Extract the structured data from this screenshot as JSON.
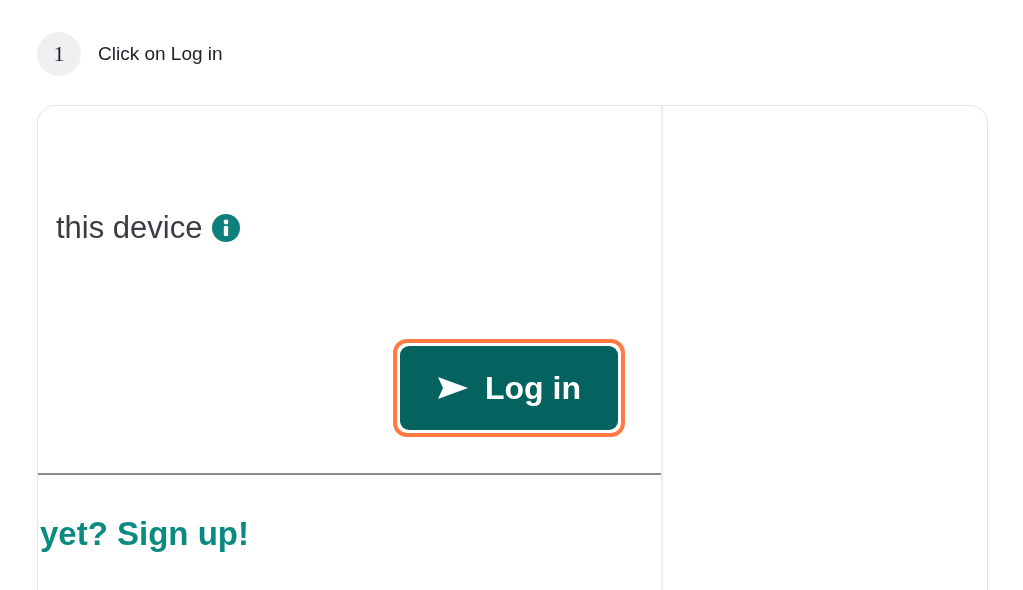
{
  "step": {
    "number": "1",
    "text": "Click on Log in"
  },
  "screenshot": {
    "remember_text": "this device",
    "login_button": {
      "label": "Log in",
      "highlighted": true
    },
    "signup_link": "yet? Sign up!"
  }
}
